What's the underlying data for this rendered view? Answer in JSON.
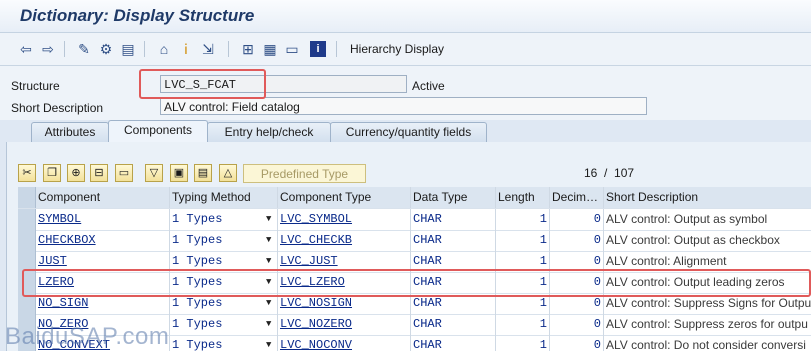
{
  "window": {
    "title": "Dictionary: Display Structure"
  },
  "toolbar": {
    "icons": [
      "back-icon",
      "forward-icon",
      "display-change-icon",
      "other-object-icon",
      "object-list-icon",
      "where-used-icon",
      "information-icon",
      "navigate-icon",
      "hierarchy-icon",
      "table-icon",
      "list-icon",
      "info-square-icon"
    ],
    "hierarchy_label": "Hierarchy Display"
  },
  "header": {
    "structure_label": "Structure",
    "structure_value": "LVC_S_FCAT",
    "status": "Active",
    "short_desc_label": "Short Description",
    "short_desc_value": "ALV control: Field catalog"
  },
  "tabs": [
    {
      "label": "Attributes",
      "active": false
    },
    {
      "label": "Components",
      "active": true
    },
    {
      "label": "Entry help/check",
      "active": false
    },
    {
      "label": "Currency/quantity fields",
      "active": false
    }
  ],
  "components_toolbar": {
    "buttons": [
      "cut-icon",
      "copy-icon",
      "insert-row-icon",
      "delete-row-icon",
      "filter-icon",
      "sort-icon",
      "detail-icon",
      "collapse-icon"
    ],
    "predefined_type_label": "Predefined Type",
    "position": "16",
    "separator": "/",
    "total": "107"
  },
  "table": {
    "columns": [
      "Component",
      "Typing Method",
      "Component Type",
      "Data Type",
      "Length",
      "Decim…",
      "Short Description"
    ],
    "rows": [
      {
        "component": "SYMBOL",
        "typing": "1 Types",
        "comp_type": "LVC_SYMBOL",
        "data_type": "CHAR",
        "length": "1",
        "decimals": "0",
        "desc": "ALV control: Output as symbol"
      },
      {
        "component": "CHECKBOX",
        "typing": "1 Types",
        "comp_type": "LVC_CHECKB",
        "data_type": "CHAR",
        "length": "1",
        "decimals": "0",
        "desc": "ALV control: Output as checkbox"
      },
      {
        "component": "JUST",
        "typing": "1 Types",
        "comp_type": "LVC_JUST",
        "data_type": "CHAR",
        "length": "1",
        "decimals": "0",
        "desc": "ALV control: Alignment"
      },
      {
        "component": "LZERO",
        "typing": "1 Types",
        "comp_type": "LVC_LZERO",
        "data_type": "CHAR",
        "length": "1",
        "decimals": "0",
        "desc": "ALV control: Output leading zeros"
      },
      {
        "component": "NO_SIGN",
        "typing": "1 Types",
        "comp_type": "LVC_NOSIGN",
        "data_type": "CHAR",
        "length": "1",
        "decimals": "0",
        "desc": "ALV control: Suppress Signs for Outpu"
      },
      {
        "component": "NO_ZERO",
        "typing": "1 Types",
        "comp_type": "LVC_NOZERO",
        "data_type": "CHAR",
        "length": "1",
        "decimals": "0",
        "desc": "ALV control: Suppress zeros for outpu"
      },
      {
        "component": "NO_CONVEXT",
        "typing": "1 Types",
        "comp_type": "LVC_NOCONV",
        "data_type": "CHAR",
        "length": "1",
        "decimals": "0",
        "desc": "ALV control: Do not consider conversi"
      }
    ]
  },
  "watermark": "BaiduSAP.com",
  "colors": {
    "highlight": "#e05a5a",
    "accent": "#1f3a68",
    "link": "#0a2a8a"
  }
}
